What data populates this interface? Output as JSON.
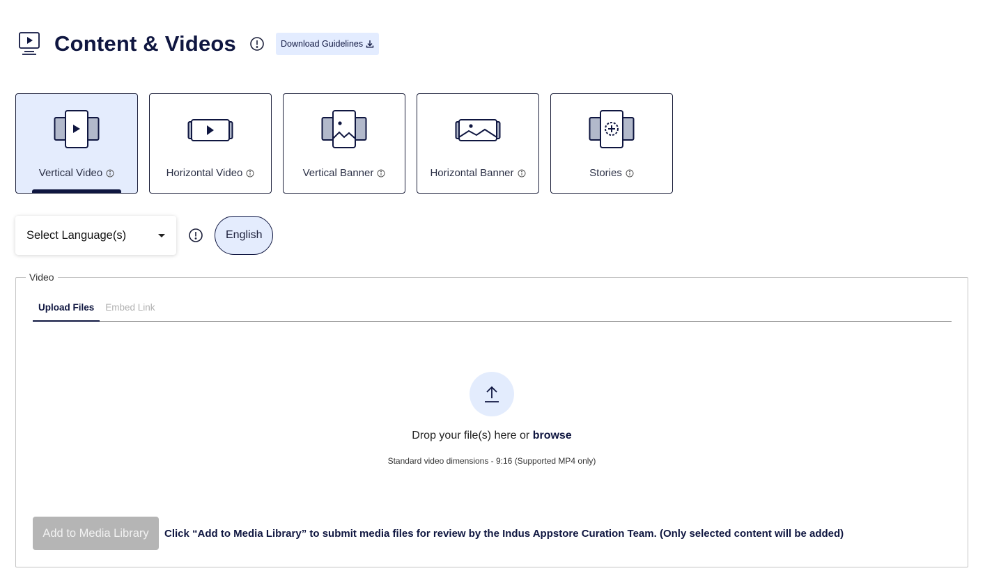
{
  "header": {
    "title": "Content & Videos",
    "title_icon": "monitor-play-icon",
    "info_icon": "exclamation-circle-icon",
    "download_label": "Download Guidelines",
    "download_icon": "download-icon"
  },
  "content_types": {
    "selected": "Vertical Video",
    "items": [
      {
        "label": "Vertical Video",
        "icon": "vertical-video-icon"
      },
      {
        "label": "Horizontal Video",
        "icon": "horizontal-video-icon"
      },
      {
        "label": "Vertical Banner",
        "icon": "vertical-banner-icon"
      },
      {
        "label": "Horizontal Banner",
        "icon": "horizontal-banner-icon"
      },
      {
        "label": "Stories",
        "icon": "stories-icon"
      }
    ]
  },
  "language": {
    "select_label": "Select Language(s)",
    "selected_chip": "English"
  },
  "video_panel": {
    "legend": "Video",
    "tabs": [
      {
        "label": "Upload Files",
        "active": true
      },
      {
        "label": "Embed Link",
        "active": false
      }
    ],
    "drop_text": "Drop your file(s) here or ",
    "browse_label": "browse",
    "dimensions_note": "Standard video dimensions - 9:16 (Supported MP4 only)",
    "add_button_label": "Add to Media Library",
    "add_note": "Click “Add to Media Library” to submit media files for review by the Indus Appstore Curation Team. (Only selected content will be added)"
  },
  "colors": {
    "brand_navy": "#0f1640",
    "selected_bg": "#e4ecfd",
    "disabled_button": "#b5b5b5"
  }
}
